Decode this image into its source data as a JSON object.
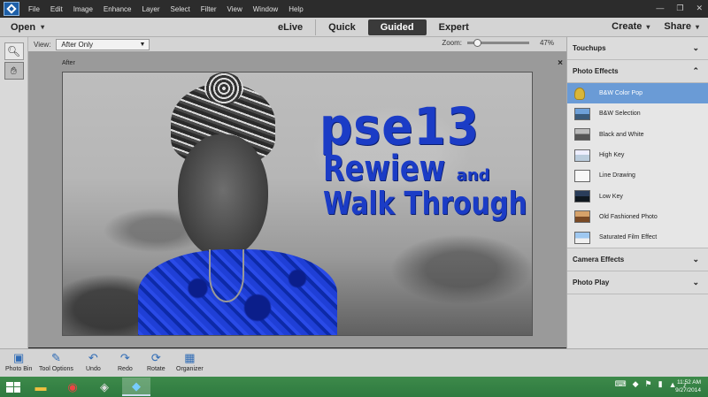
{
  "menubar": {
    "items": [
      "File",
      "Edit",
      "Image",
      "Enhance",
      "Layer",
      "Select",
      "Filter",
      "View",
      "Window",
      "Help"
    ],
    "controls": {
      "minimize": "—",
      "maximize": "❐",
      "close": "✕"
    }
  },
  "modebar": {
    "open_label": "Open",
    "modes": [
      "eLive",
      "Quick",
      "Guided",
      "Expert"
    ],
    "active_mode": "Guided",
    "create_label": "Create",
    "share_label": "Share"
  },
  "options": {
    "view_label": "View:",
    "view_value": "After Only",
    "zoom_label": "Zoom:",
    "zoom_value": "47%"
  },
  "canvas": {
    "after_label": "After",
    "close": "×",
    "title_line1": "pse13",
    "title_line2": "Rewiew",
    "title_and": "and",
    "title_line3": "Walk Through"
  },
  "panel": {
    "touchups": "Touchups",
    "photo_effects": "Photo Effects",
    "effects": [
      {
        "label": "B&W Color Pop",
        "selected": true
      },
      {
        "label": "B&W Selection"
      },
      {
        "label": "Black and White"
      },
      {
        "label": "High Key"
      },
      {
        "label": "Line Drawing"
      },
      {
        "label": "Low Key"
      },
      {
        "label": "Old Fashioned Photo"
      },
      {
        "label": "Saturated Film Effect"
      }
    ],
    "camera_effects": "Camera Effects",
    "photo_play": "Photo Play"
  },
  "bottombar": {
    "photo_bin": "Photo Bin",
    "tool_options": "Tool Options",
    "undo": "Undo",
    "redo": "Redo",
    "rotate": "Rotate",
    "organizer": "Organizer"
  },
  "taskbar": {
    "time": "11:52 AM",
    "date": "9/27/2014"
  },
  "colors": {
    "accent_selected": "#6a9bd6",
    "title_blue": "#1b3cc6",
    "taskbar_green": "#2f7a40"
  }
}
